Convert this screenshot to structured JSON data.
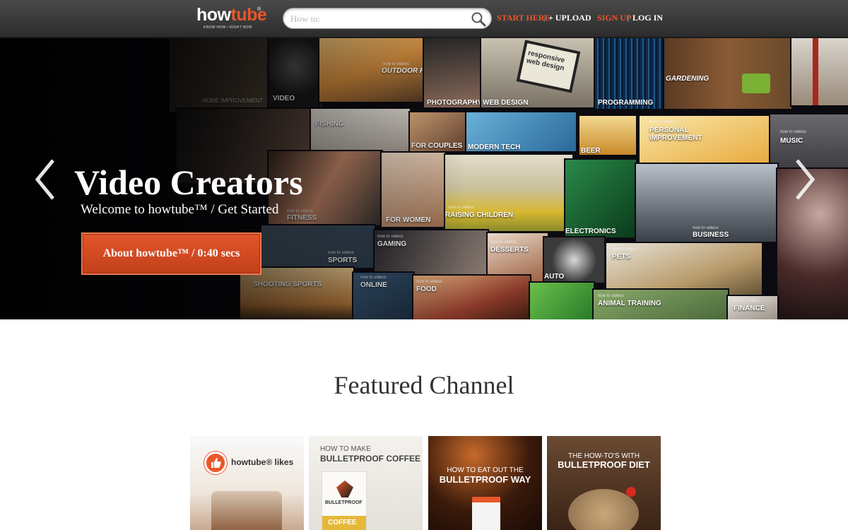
{
  "header": {
    "logo": {
      "how": "how",
      "tube": "tube",
      "reg": "®",
      "tagline": "KNOW HOW • RIGHT NOW"
    },
    "search": {
      "placeholder": "How to:"
    },
    "nav": {
      "start_here": "START HERE",
      "separator": "|",
      "upload": "+ UPLOAD",
      "sign_up": "SIGN UP",
      "log_in": "LOG IN"
    }
  },
  "hero": {
    "title": "Video Creators",
    "subtitle": "Welcome to howtube™ / Get Started",
    "button": "About howtube™ / 0:40 secs",
    "tile_prefix": "how to videos",
    "categories": [
      "HOME IMPROVEMENT",
      "VIDEO",
      "OUTDOOR FUN",
      "PHOTOGRAPHY",
      "WEB DESIGN",
      "PROGRAMMING",
      "GARDENING",
      "FISHING",
      "FOR COUPLES",
      "MODERN TECH",
      "BEER",
      "PERSONAL IMPROVEMENT",
      "MUSIC",
      "FITNESS",
      "FOR WOMEN",
      "RAISING CHILDREN",
      "ELECTRONICS",
      "BUSINESS",
      "SPORTS",
      "GAMING",
      "DESSERTS",
      "PETS",
      "SHOOTING SPORTS",
      "ONLINE",
      "FOOD",
      "AUTO",
      "ANIMAL TRAINING",
      "FINANCE"
    ],
    "web_design_art": "responsive web design"
  },
  "featured": {
    "title": "Featured Channel",
    "cards": [
      {
        "line1": "",
        "line2": "howtube® likes"
      },
      {
        "line1": "HOW TO MAKE",
        "line2": "BULLETPROOF COFFEE",
        "product": "BULLETPROOF",
        "product_sub": "COFFEE"
      },
      {
        "line1": "HOW TO EAT OUT THE",
        "line2": "BULLETPROOF WAY"
      },
      {
        "line1": "THE HOW-TO'S WITH",
        "line2": "BULLETPROOF DIET"
      }
    ]
  },
  "colors": {
    "accent": "#e8572a",
    "topbar": "#3a3a3a",
    "hero_bg": "#0a0a10"
  }
}
